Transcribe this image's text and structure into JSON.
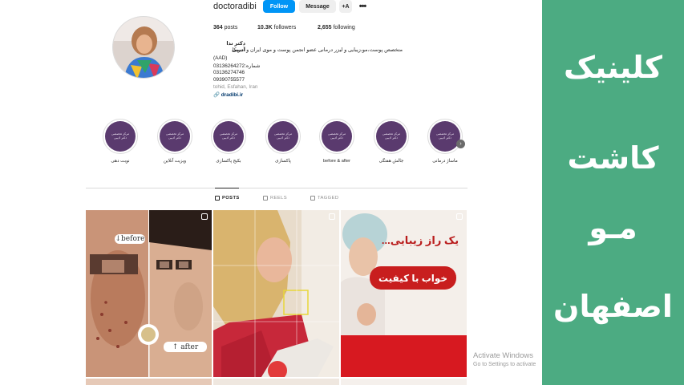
{
  "profile": {
    "username": "doctoradibi",
    "follow_label": "Follow",
    "message_label": "Message",
    "add_user_icon": "+A",
    "more_icon": "•••",
    "posts_count": "364",
    "posts_label": "posts",
    "followers_count": "10.3K",
    "followers_label": "followers",
    "following_count": "2,655",
    "following_label": "following",
    "display_name": "دکتر ندا ادیبی",
    "bio_line1": "متخصص پوست،مو،زیبایی و لیزر درمانی عضو انجمن پوست و موی ایران و آمریکا",
    "bio_line2": "(AAD)",
    "bio_line3": "شماره:03136264272",
    "bio_line4": "03136274746",
    "bio_line5": "09390755577",
    "location": "tohid, Esfahan, Iran",
    "link": "dradibi.ir"
  },
  "highlights": [
    {
      "label": "ماساژ درمانی",
      "cover_line1": "مرکز تخصصی",
      "cover_line2": "دکتر ادیبی"
    },
    {
      "label": "جالش هفتگی",
      "cover_line1": "مرکز تخصصی",
      "cover_line2": "دکتر ادیبی"
    },
    {
      "label": "before & after",
      "cover_line1": "مرکز تخصصی",
      "cover_line2": "دکتر ادیبی"
    },
    {
      "label": "پاکسازی",
      "cover_line1": "مرکز تخصصی",
      "cover_line2": "دکتر ادیبی"
    },
    {
      "label": "بکیج پاکسازی",
      "cover_line1": "مرکز تخصصی",
      "cover_line2": "دکتر ادیبی"
    },
    {
      "label": "ویزیت آنلاین",
      "cover_line1": "مرکز تخصصی",
      "cover_line2": "دکتر ادیبی"
    },
    {
      "label": "نوبت دهی",
      "cover_line1": "مرکز تخصصی",
      "cover_line2": "دکتر ادیبی"
    }
  ],
  "tabs": {
    "posts": "POSTS",
    "reels": "REELS",
    "tagged": "TAGGED"
  },
  "posts": {
    "p1_before": "↓before",
    "p1_after": "↑ after",
    "p3_title": "یک راز زیبایی...",
    "p3_pill": "خواب با کیفیت"
  },
  "watermark": {
    "line1": "Activate Windows",
    "line2": "Go to Settings to activate"
  },
  "banner": {
    "line1": "کلینیک",
    "line2": "کاشت",
    "line3": "مـو",
    "line4": "اصفهان",
    "bg_color": "#4cab82"
  },
  "colors": {
    "follow_blue": "#0095f6",
    "highlight_purple": "#5a3a6e",
    "post_red": "#d71920"
  }
}
